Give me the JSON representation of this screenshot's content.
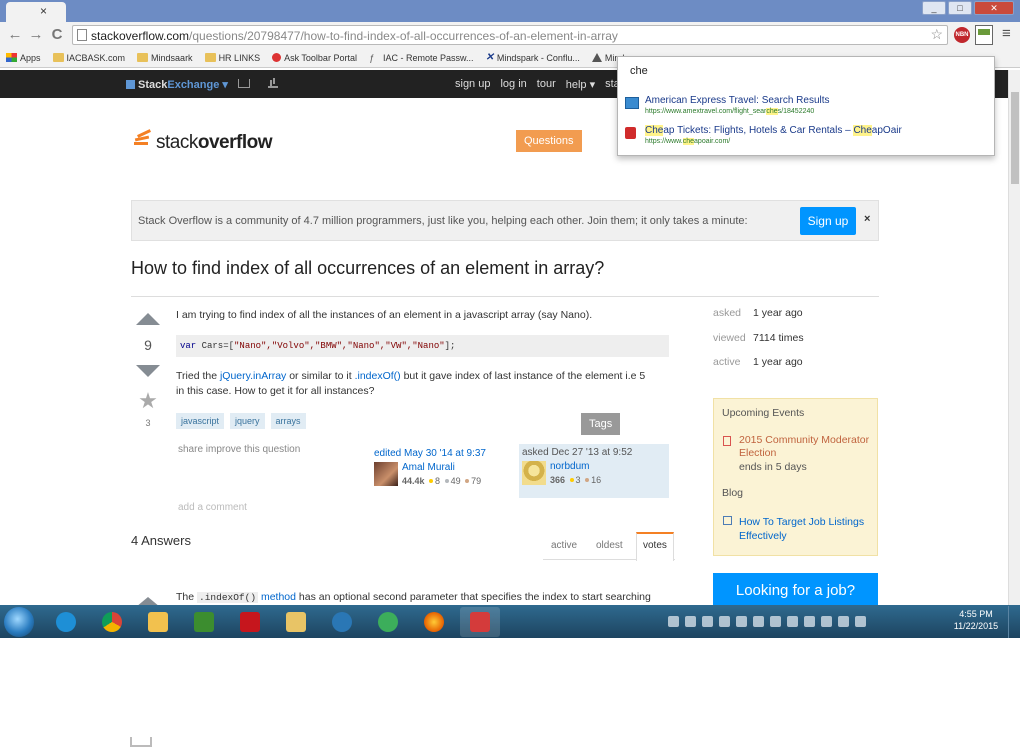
{
  "browser": {
    "tab_close": "×",
    "url_host": "stackoverflow.com",
    "url_path": "/questions/20798477/how-to-find-index-of-all-occurrences-of-an-element-in-array",
    "nav": {
      "back": "←",
      "forward": "→",
      "reload": "C"
    },
    "bookmarks": [
      {
        "label": "Apps",
        "icon": "apps-icon"
      },
      {
        "label": "IACBASK.com",
        "icon": "folder-icon"
      },
      {
        "label": "Mindsaark",
        "icon": "folder-icon"
      },
      {
        "label": "HR LINKS",
        "icon": "folder-icon"
      },
      {
        "label": "Ask Toolbar Portal",
        "icon": "ask-icon"
      },
      {
        "label": "IAC - Remote Passw...",
        "icon": "pen-icon"
      },
      {
        "label": "Mindspark - Conflu...",
        "icon": "x-icon"
      },
      {
        "label": "Mind",
        "icon": "person-icon"
      }
    ],
    "window_buttons": {
      "minimize": "_",
      "maximize": "□",
      "close": "✕"
    },
    "ext_badge": "NBN"
  },
  "omnibox_dropdown": {
    "query": "che",
    "items": [
      {
        "title": "American Express Travel: Search Results",
        "url_before": "https://www.amextravel.com/flight_sear",
        "url_match": "che",
        "url_after": "s/18452240"
      },
      {
        "title_match1": "Che",
        "title_mid": "ap Tickets: Flights, Hotels & Car Rentals – ",
        "title_match2": "Che",
        "title_end": "apOair",
        "url_before": "https://www.",
        "url_match": "che",
        "url_after": "apoair.com/"
      }
    ]
  },
  "se_bar": {
    "brand_stack": "Stack",
    "brand_exchange": "Exchange ▾",
    "links": [
      "sign up",
      "log in",
      "tour",
      "help ▾",
      "stack"
    ]
  },
  "site": {
    "logo_word_light": "stack",
    "logo_word_bold": "overflow",
    "nav": {
      "questions": "Questions",
      "tags": "Tags"
    }
  },
  "banner": {
    "message": "Stack Overflow is a community of 4.7 million programmers, just like you, helping each other. Join them; it only takes a minute:",
    "signup": "Sign up",
    "close": "×"
  },
  "question": {
    "title": "How to find index of all occurrences of an element in array?",
    "votes": "9",
    "favorites": "3",
    "intro": "I am trying to find index of all the instances of an element in a javascript array (say Nano).",
    "code_kw": "var",
    "code_rest": " Cars=[",
    "code_strings": "\"Nano\",\"Volvo\",\"BMW\",\"Nano\",\"VW\",\"Nano\"",
    "code_end": "];",
    "line2_a": "Tried the ",
    "line2_link1": "jQuery.inArray",
    "line2_b": " or similar to it ",
    "line2_link2": ".indexOf()",
    "line2_c": " but it gave index of last instance of the element i.e 5",
    "line3": "in this case. How to get it for all instances?",
    "tags": [
      "javascript",
      "jquery",
      "arrays"
    ],
    "post_menu": "share  improve this question",
    "add_comment": "add a comment",
    "editor": {
      "action": "edited May 30 '14 at 9:37",
      "name": "Amal Murali",
      "rep": "44.4k",
      "gold": "8",
      "silver": "49",
      "bronze": "79"
    },
    "owner": {
      "action": "asked Dec 27 '13 at 9:52",
      "name": "norbdum",
      "rep": "366",
      "gold": "3",
      "silver": "",
      "bronze": "16"
    }
  },
  "sidebar": {
    "stats": [
      {
        "label": "asked",
        "value": "1 year ago"
      },
      {
        "label": "viewed",
        "value": "7114 times"
      },
      {
        "label": "active",
        "value": "1 year ago"
      }
    ],
    "events_head": "Upcoming Events",
    "event_title": "2015 Community Moderator Election",
    "event_sub": "ends in 5 days",
    "blog_head": "Blog",
    "blog_link": "How To Target Job Listings Effectively",
    "job_button": "Looking for a job?"
  },
  "answers": {
    "count": "4 Answers",
    "sort_tabs": [
      "active",
      "oldest",
      "votes"
    ],
    "first_a": "The ",
    "first_code": ".indexOf()",
    "first_link": " method",
    "first_b": " has an optional second parameter that specifies the index to start searching"
  },
  "taskbar": {
    "time": "4:55 PM",
    "date": "11/22/2015"
  }
}
